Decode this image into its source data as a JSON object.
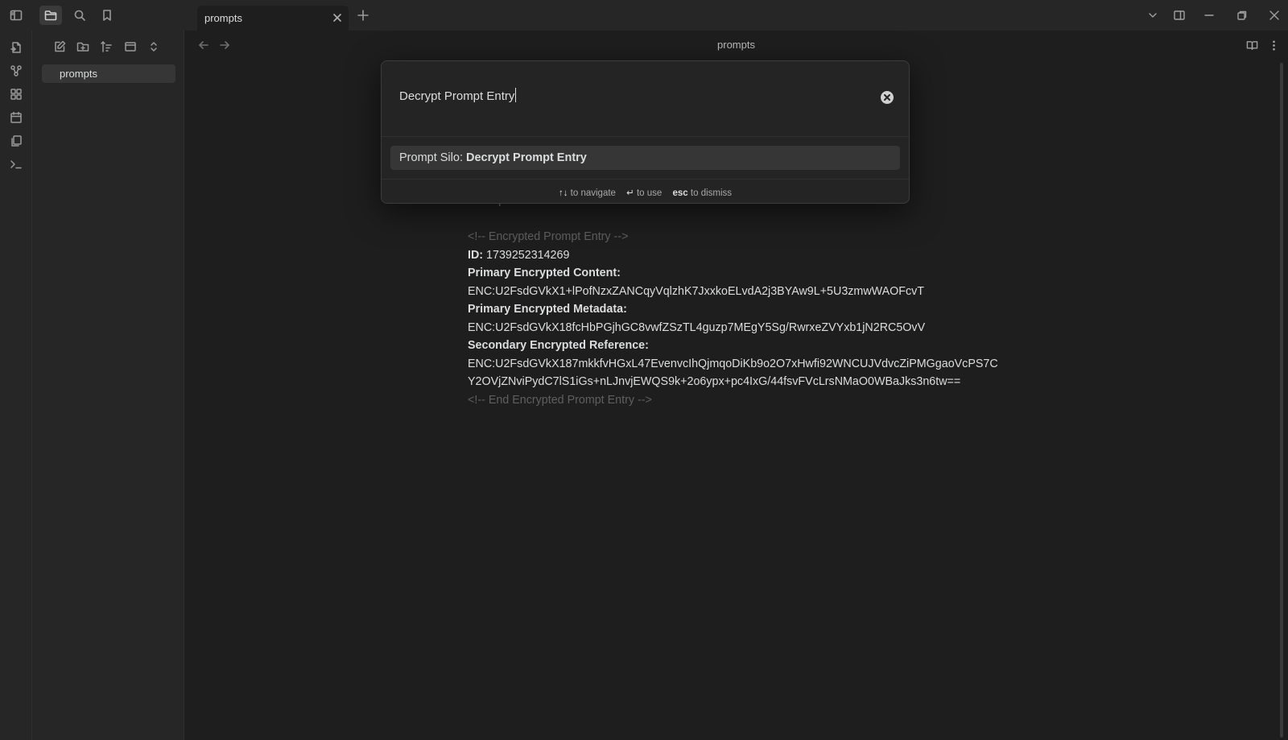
{
  "tab": {
    "title": "prompts"
  },
  "sidebar": {
    "files": [
      {
        "label": "prompts"
      }
    ]
  },
  "view": {
    "title": "prompts"
  },
  "command_palette": {
    "query": "Decrypt Prompt Entry",
    "suggestion_prefix": "Prompt Silo: ",
    "suggestion_name": "Decrypt Prompt Entry",
    "hints": [
      {
        "key": "↑↓",
        "text": "to navigate"
      },
      {
        "key": "↵",
        "text": "to use"
      },
      {
        "key": "esc",
        "text": "to dismiss"
      }
    ]
  },
  "document": {
    "partial_line": "backupInterval = \"15\"",
    "comment_start": "<!-- Encrypted Prompt Entry -->",
    "id_label": "ID:",
    "id_value": "1739252314269",
    "content_label": "Primary Encrypted Content:",
    "content_value": "ENC:U2FsdGVkX1+lPofNzxZANCqyVqlzhK7JxxkoELvdA2j3BYAw9L+5U3zmwWAOFcvT",
    "metadata_label": "Primary Encrypted Metadata:",
    "metadata_value": "ENC:U2FsdGVkX18fcHbPGjhGC8vwfZSzTL4guzp7MEgY5Sg/RwrxeZVYxb1jN2RC5OvV",
    "reference_label": "Secondary Encrypted Reference:",
    "reference_value_1": "ENC:U2FsdGVkX187mkkfvHGxL47EvenvcIhQjmqoDiKb9o2O7xHwfi92WNCUJVdvcZiPMGgaoVcPS7C",
    "reference_value_2": "Y2OVjZNviPydC7lS1iGs+nLJnvjEWQS9k+2o6ypx+pc4IxG/44fsvFVcLrsNMaO0WBaJks3n6tw==",
    "comment_end": "<!-- End Encrypted Prompt Entry -->"
  },
  "colors": {
    "background": "#1e1e1e",
    "panel": "#262626",
    "modal": "#242424",
    "selected": "#363636"
  }
}
